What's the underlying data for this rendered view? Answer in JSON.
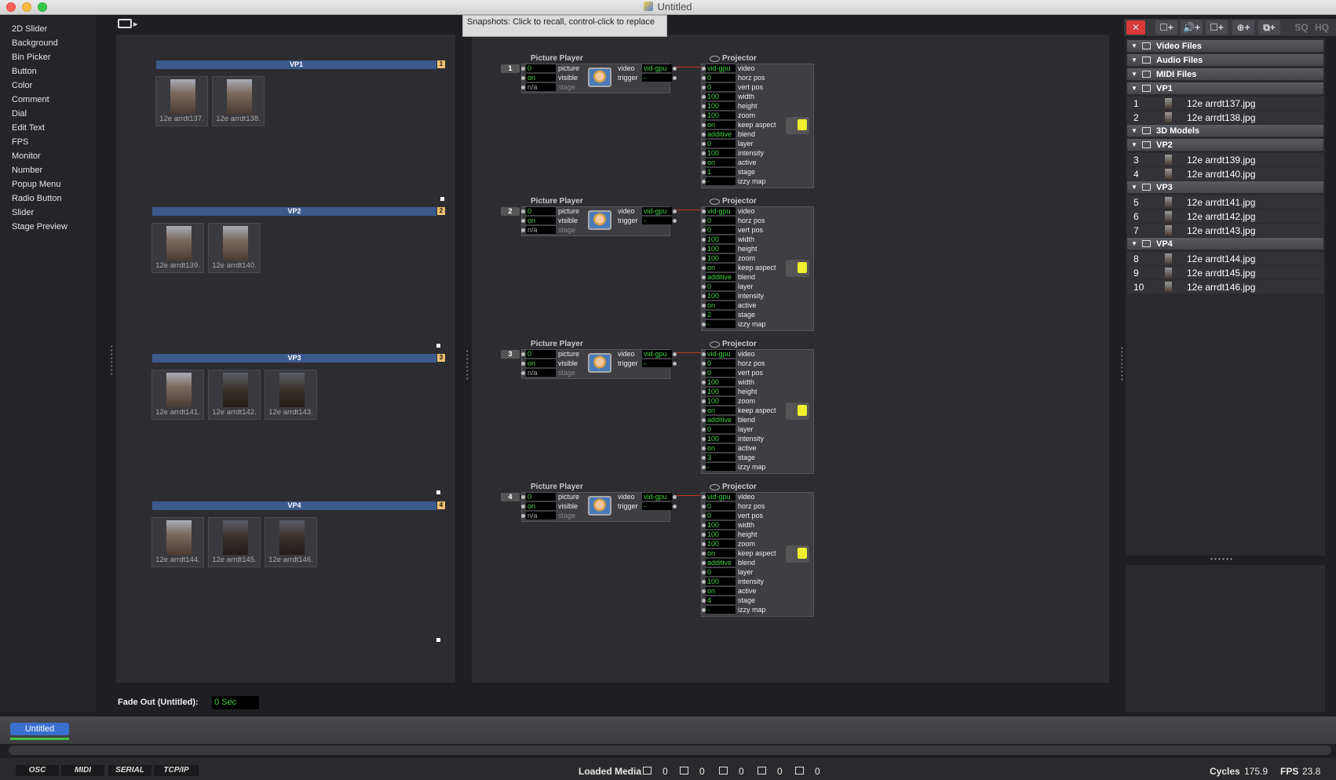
{
  "window": {
    "title": "Untitled"
  },
  "controls_palette": [
    "2D Slider",
    "Background",
    "Bin Picker",
    "Button",
    "Color",
    "Comment",
    "Dial",
    "Edit Text",
    "FPS",
    "Monitor",
    "Number",
    "Popup Menu",
    "Radio Button",
    "Slider",
    "Stage Preview"
  ],
  "tooltip": "Snapshots: Click to recall, control-click to replace",
  "control_panel": {
    "groups": [
      {
        "label": "VP1",
        "num": "1",
        "thumbs": [
          "12e arrdt137.",
          "12e arrdt138."
        ]
      },
      {
        "label": "VP2",
        "num": "2",
        "thumbs": [
          "12e arrdt139.",
          "12e arrdt140."
        ]
      },
      {
        "label": "VP3",
        "num": "3",
        "thumbs": [
          "12e arrdt141.",
          "12e arrdt142.",
          "12e arrdt143."
        ]
      },
      {
        "label": "VP4",
        "num": "4",
        "thumbs": [
          "12e arrdt144.",
          "12e arrdt145.",
          "12e arrdt146."
        ]
      }
    ],
    "fade_label": "Fade Out (Untitled):",
    "fade_value": "0 Sec"
  },
  "patch": {
    "picture_player_title": "Picture Player",
    "projector_title": "Projector",
    "chains": [
      {
        "index": "1",
        "stage": "1"
      },
      {
        "index": "2",
        "stage": "2"
      },
      {
        "index": "3",
        "stage": "3"
      },
      {
        "index": "4",
        "stage": "4"
      }
    ],
    "pp_inputs": [
      {
        "value": "0",
        "label": "picture"
      },
      {
        "value": "on",
        "label": "visible"
      },
      {
        "value": "n/a",
        "label": "stage"
      }
    ],
    "pp_outputs": [
      {
        "label": "video",
        "value": "vid-gpu"
      },
      {
        "label": "trigger",
        "value": "-"
      }
    ],
    "proj_inputs": [
      {
        "value": "vid-gpu",
        "label": "video"
      },
      {
        "value": "0",
        "label": "horz pos"
      },
      {
        "value": "0",
        "label": "vert pos"
      },
      {
        "value": "100",
        "label": "width"
      },
      {
        "value": "100",
        "label": "height"
      },
      {
        "value": "100",
        "label": "zoom"
      },
      {
        "value": "on",
        "label": "keep aspect"
      },
      {
        "value": "additive",
        "label": "blend"
      },
      {
        "value": "0",
        "label": "layer"
      },
      {
        "value": "100",
        "label": "intensity"
      },
      {
        "value": "on",
        "label": "active"
      },
      {
        "value": "",
        "label": "stage"
      },
      {
        "value": "-",
        "label": "izzy map"
      }
    ]
  },
  "media": {
    "toolbar": [
      "✕",
      "☐+",
      "🔊+",
      "☐+",
      "⊕+",
      "⧉+",
      "SQ",
      "HQ"
    ],
    "groups_top": [
      "Video Files",
      "Audio Files",
      "MIDI Files"
    ],
    "bins": [
      {
        "name": "VP1",
        "files": [
          {
            "n": "1",
            "name": "12e arrdt137.jpg"
          },
          {
            "n": "2",
            "name": "12e arrdt138.jpg"
          }
        ]
      },
      {
        "name": "3D Models",
        "files": []
      },
      {
        "name": "VP2",
        "files": [
          {
            "n": "3",
            "name": "12e arrdt139.jpg"
          },
          {
            "n": "4",
            "name": "12e arrdt140.jpg"
          }
        ]
      },
      {
        "name": "VP3",
        "files": [
          {
            "n": "5",
            "name": "12e arrdt141.jpg"
          },
          {
            "n": "6",
            "name": "12e arrdt142.jpg"
          },
          {
            "n": "7",
            "name": "12e arrdt143.jpg"
          }
        ]
      },
      {
        "name": "VP4",
        "files": [
          {
            "n": "8",
            "name": "12e arrdt144.jpg"
          },
          {
            "n": "9",
            "name": "12e arrdt145.jpg"
          },
          {
            "n": "10",
            "name": "12e arrdt146.jpg"
          }
        ]
      }
    ]
  },
  "scene_tab": "Untitled",
  "status": {
    "protocols": [
      "OSC",
      "MIDI",
      "SERIAL",
      "TCP/IP"
    ],
    "loaded_media_label": "Loaded Media",
    "counts": [
      "0",
      "0",
      "0",
      "0",
      "0"
    ],
    "cycles_label": "Cycles",
    "cycles_value": "175.9",
    "fps_label": "FPS",
    "fps_value": "23.8"
  }
}
